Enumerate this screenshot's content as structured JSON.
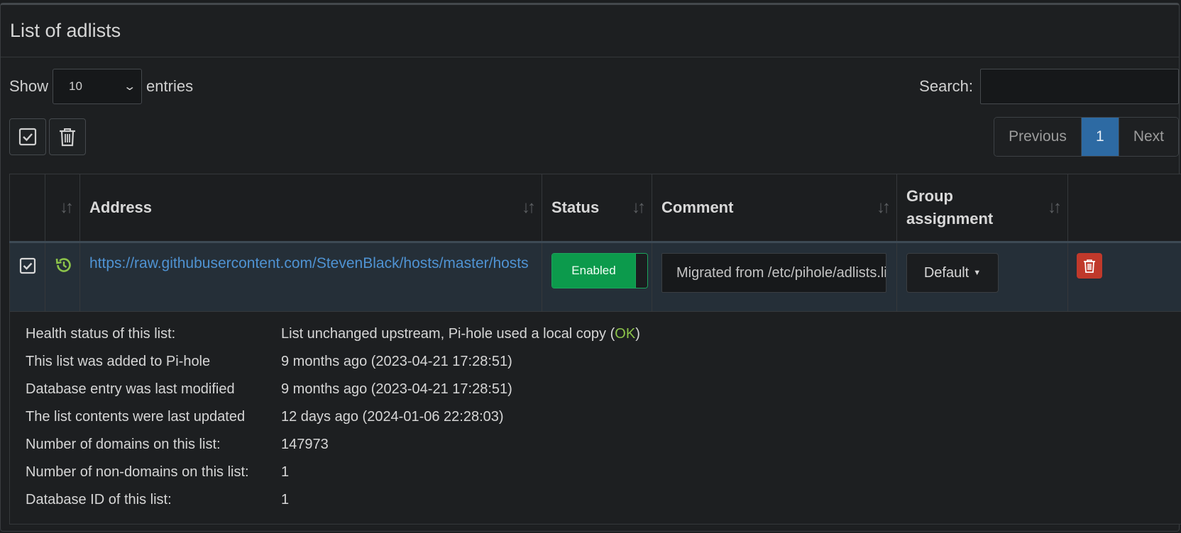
{
  "title": "List of adlists",
  "length": {
    "show_label": "Show",
    "value": "10",
    "entries_label": "entries"
  },
  "search": {
    "label": "Search:",
    "value": ""
  },
  "pagination": {
    "previous": "Previous",
    "page": "1",
    "next": "Next"
  },
  "table": {
    "headers": {
      "address": "Address",
      "status": "Status",
      "comment": "Comment",
      "group_line1": "Group",
      "group_line2": "assignment"
    },
    "row": {
      "address": "https://raw.githubusercontent.com/StevenBlack/hosts/master/hosts",
      "status": "Enabled",
      "comment": "Migrated from /etc/pihole/adlists.list",
      "group": "Default"
    }
  },
  "details": {
    "health_label": "Health status of this list:",
    "health_value": "List unchanged upstream, Pi-hole used a local copy (",
    "health_ok": "OK",
    "health_close": ")",
    "added_label": "This list was added to Pi-hole",
    "added_value": "9 months ago (2023-04-21 17:28:51)",
    "modified_label": "Database entry was last modified",
    "modified_value": "9 months ago (2023-04-21 17:28:51)",
    "updated_label": "The list contents were last updated",
    "updated_value": "12 days ago (2024-01-06 22:28:03)",
    "domains_label": "Number of domains on this list:",
    "domains_value": "147973",
    "nondomains_label": "Number of non-domains on this list:",
    "nondomains_value": "1",
    "dbid_label": "Database ID of this list:",
    "dbid_value": "1"
  },
  "colors": {
    "background": "#1d1f21",
    "link": "#4f93d3",
    "enabled": "#0c9a4c",
    "active_page": "#2d6aa3",
    "delete": "#c0392b",
    "ok": "#8cc34a"
  },
  "icons": {
    "select_all": "checkbox-checked-icon",
    "delete_selected": "trash-icon",
    "sort": "sort-arrows-icon",
    "history": "history-icon",
    "row_delete": "trash-icon"
  }
}
